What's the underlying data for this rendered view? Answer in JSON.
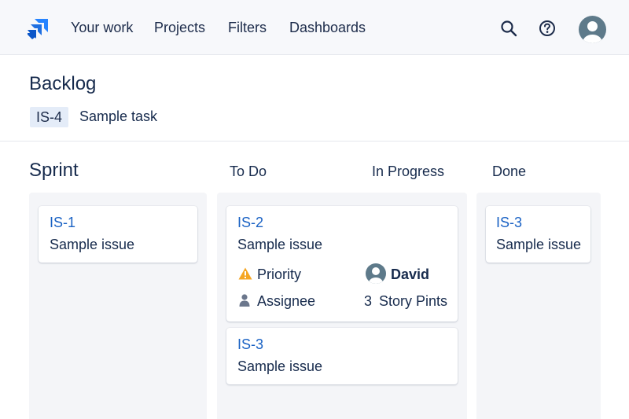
{
  "nav": {
    "items": [
      "Your work",
      "Projects",
      "Filters",
      "Dashboards"
    ]
  },
  "icons": {
    "logo": "jira-logo",
    "search": "search-icon",
    "help": "help-icon",
    "avatar": "user-avatar-icon"
  },
  "colors": {
    "accent": "#1a62c4",
    "logo": "#2684ff",
    "priority_warning": "#f5a623",
    "avatar_bg": "#5e7a8a"
  },
  "backlog": {
    "title": "Backlog",
    "issue": {
      "key": "IS-4",
      "summary": "Sample task"
    }
  },
  "board": {
    "sprint_title": "Sprint",
    "columns": [
      "To Do",
      "In Progress",
      "Done"
    ],
    "sprint_cards": [
      {
        "key": "IS-1",
        "summary": "Sample issue"
      }
    ],
    "todo_cards": [
      {
        "key": "IS-2",
        "summary": "Sample issue",
        "priority_label": "Priority",
        "assignee_label": "Assignee",
        "assignee_name": "David",
        "story_points": "3",
        "story_points_label": "Story Pints"
      },
      {
        "key": "IS-3",
        "summary": "Sample issue"
      }
    ],
    "done_cards": [
      {
        "key": "IS-3",
        "summary": "Sample issue"
      }
    ]
  }
}
